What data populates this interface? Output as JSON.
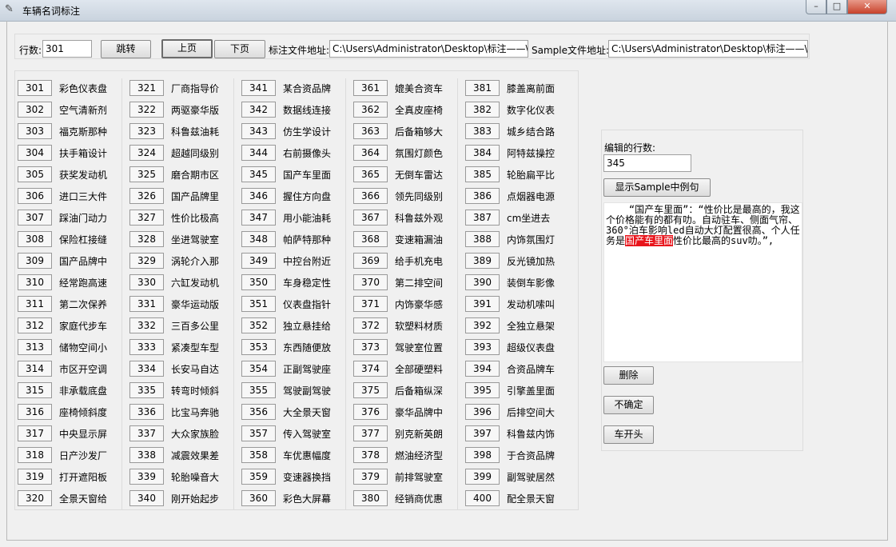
{
  "window": {
    "title": "车辆名词标注",
    "minimize": "–",
    "maximize": "□",
    "close": "✕"
  },
  "toolbar": {
    "row_label": "行数:",
    "row_value": "301",
    "jump_label": "跳转",
    "prev_label": "上页",
    "next_label": "下页",
    "annot_path_label": "标注文件地址:",
    "annot_path_value": "C:\\Users\\Administrator\\Desktop\\标注——\\",
    "sample_path_label": "Sample文件地址:",
    "sample_path_value": "C:\\Users\\Administrator\\Desktop\\标注——\\"
  },
  "rows": [
    {
      "num": "301",
      "word": "彩色仪表盘"
    },
    {
      "num": "302",
      "word": "空气清新剂"
    },
    {
      "num": "303",
      "word": "福克斯那种"
    },
    {
      "num": "304",
      "word": "扶手箱设计"
    },
    {
      "num": "305",
      "word": "获奖发动机"
    },
    {
      "num": "306",
      "word": "进口三大件"
    },
    {
      "num": "307",
      "word": "踩油门动力"
    },
    {
      "num": "308",
      "word": "保险杠接缝"
    },
    {
      "num": "309",
      "word": "国产品牌中"
    },
    {
      "num": "310",
      "word": "经常跑高速"
    },
    {
      "num": "311",
      "word": "第二次保养"
    },
    {
      "num": "312",
      "word": "家庭代步车"
    },
    {
      "num": "313",
      "word": "储物空间小"
    },
    {
      "num": "314",
      "word": "市区开空调"
    },
    {
      "num": "315",
      "word": "非承载底盘"
    },
    {
      "num": "316",
      "word": "座椅倾斜度"
    },
    {
      "num": "317",
      "word": "中央显示屏"
    },
    {
      "num": "318",
      "word": "日产沙发厂"
    },
    {
      "num": "319",
      "word": "打开遮阳板"
    },
    {
      "num": "320",
      "word": "全景天窗给"
    },
    {
      "num": "321",
      "word": "厂商指导价"
    },
    {
      "num": "322",
      "word": "两驱豪华版"
    },
    {
      "num": "323",
      "word": "科鲁兹油耗"
    },
    {
      "num": "324",
      "word": "超越同级别"
    },
    {
      "num": "325",
      "word": "磨合期市区"
    },
    {
      "num": "326",
      "word": "国产品牌里"
    },
    {
      "num": "327",
      "word": "性价比极高"
    },
    {
      "num": "328",
      "word": "坐进驾驶室"
    },
    {
      "num": "329",
      "word": "涡轮介入那"
    },
    {
      "num": "330",
      "word": "六缸发动机"
    },
    {
      "num": "331",
      "word": "豪华运动版"
    },
    {
      "num": "332",
      "word": "三百多公里"
    },
    {
      "num": "333",
      "word": "紧凑型车型"
    },
    {
      "num": "334",
      "word": "长安马自达"
    },
    {
      "num": "335",
      "word": "转弯时倾斜"
    },
    {
      "num": "336",
      "word": "比宝马奔驰"
    },
    {
      "num": "337",
      "word": "大众家族脸"
    },
    {
      "num": "338",
      "word": "减震效果差"
    },
    {
      "num": "339",
      "word": "轮胎噪音大"
    },
    {
      "num": "340",
      "word": "刚开始起步"
    },
    {
      "num": "341",
      "word": "某合资品牌"
    },
    {
      "num": "342",
      "word": "数据线连接"
    },
    {
      "num": "343",
      "word": "仿生学设计"
    },
    {
      "num": "344",
      "word": "右前摄像头"
    },
    {
      "num": "345",
      "word": "国产车里面"
    },
    {
      "num": "346",
      "word": "握住方向盘"
    },
    {
      "num": "347",
      "word": "用小能油耗"
    },
    {
      "num": "348",
      "word": "帕萨特那种"
    },
    {
      "num": "349",
      "word": "中控台附近"
    },
    {
      "num": "350",
      "word": "车身稳定性"
    },
    {
      "num": "351",
      "word": "仪表盘指针"
    },
    {
      "num": "352",
      "word": "独立悬挂给"
    },
    {
      "num": "353",
      "word": "东西随便放"
    },
    {
      "num": "354",
      "word": "正副驾驶座"
    },
    {
      "num": "355",
      "word": "驾驶副驾驶"
    },
    {
      "num": "356",
      "word": "大全景天窗"
    },
    {
      "num": "357",
      "word": "传入驾驶室"
    },
    {
      "num": "358",
      "word": "车优惠幅度"
    },
    {
      "num": "359",
      "word": "变速器换挡"
    },
    {
      "num": "360",
      "word": "彩色大屏幕"
    },
    {
      "num": "361",
      "word": "媲美合资车"
    },
    {
      "num": "362",
      "word": "全真皮座椅"
    },
    {
      "num": "363",
      "word": "后备箱够大"
    },
    {
      "num": "364",
      "word": "氛围灯颜色"
    },
    {
      "num": "365",
      "word": "无倒车雷达"
    },
    {
      "num": "366",
      "word": "领先同级别"
    },
    {
      "num": "367",
      "word": "科鲁兹外观"
    },
    {
      "num": "368",
      "word": "变速箱漏油"
    },
    {
      "num": "369",
      "word": "给手机充电"
    },
    {
      "num": "370",
      "word": "第二排空间"
    },
    {
      "num": "371",
      "word": "内饰豪华感"
    },
    {
      "num": "372",
      "word": "软塑料材质"
    },
    {
      "num": "373",
      "word": "驾驶室位置"
    },
    {
      "num": "374",
      "word": "全部硬塑料"
    },
    {
      "num": "375",
      "word": "后备箱纵深"
    },
    {
      "num": "376",
      "word": "豪华品牌中"
    },
    {
      "num": "377",
      "word": "别克新英朗"
    },
    {
      "num": "378",
      "word": "燃油经济型"
    },
    {
      "num": "379",
      "word": "前排驾驶室"
    },
    {
      "num": "380",
      "word": "经销商优惠"
    },
    {
      "num": "381",
      "word": "膝盖离前面"
    },
    {
      "num": "382",
      "word": "数字化仪表"
    },
    {
      "num": "383",
      "word": "城乡结合路"
    },
    {
      "num": "384",
      "word": "阿特兹操控"
    },
    {
      "num": "385",
      "word": "轮胎扁平比"
    },
    {
      "num": "386",
      "word": "点烟器电源"
    },
    {
      "num": "387",
      "word": "cm坐进去"
    },
    {
      "num": "388",
      "word": "内饰氛围灯"
    },
    {
      "num": "389",
      "word": "反光镜加热"
    },
    {
      "num": "390",
      "word": "装倒车影像"
    },
    {
      "num": "391",
      "word": "发动机嗦叫"
    },
    {
      "num": "392",
      "word": "全独立悬架"
    },
    {
      "num": "393",
      "word": "超级仪表盘"
    },
    {
      "num": "394",
      "word": "合资品牌车"
    },
    {
      "num": "395",
      "word": "引擎盖里面"
    },
    {
      "num": "396",
      "word": "后排空间大"
    },
    {
      "num": "397",
      "word": "科鲁兹内饰"
    },
    {
      "num": "398",
      "word": "于合资品牌"
    },
    {
      "num": "399",
      "word": "副驾驶居然"
    },
    {
      "num": "400",
      "word": "配全景天窗"
    }
  ],
  "edit": {
    "label": "编辑的行数:",
    "value": "345",
    "show_sample_label": "显示Sample中例句",
    "text_before": "    “国产车里面”：“性价比是最高的，我这个价格能有的都有叻。自动驻车、侧面气帘、360°泊车影响led自动大灯配置很高、个人任务是",
    "text_highlight": "国产车里面",
    "text_after": "性价比最高的suv叻。”,",
    "delete_label": "删除",
    "uncertain_label": "不确定",
    "car_head_label": "车开头",
    "highlight_color": "#e8141b"
  }
}
